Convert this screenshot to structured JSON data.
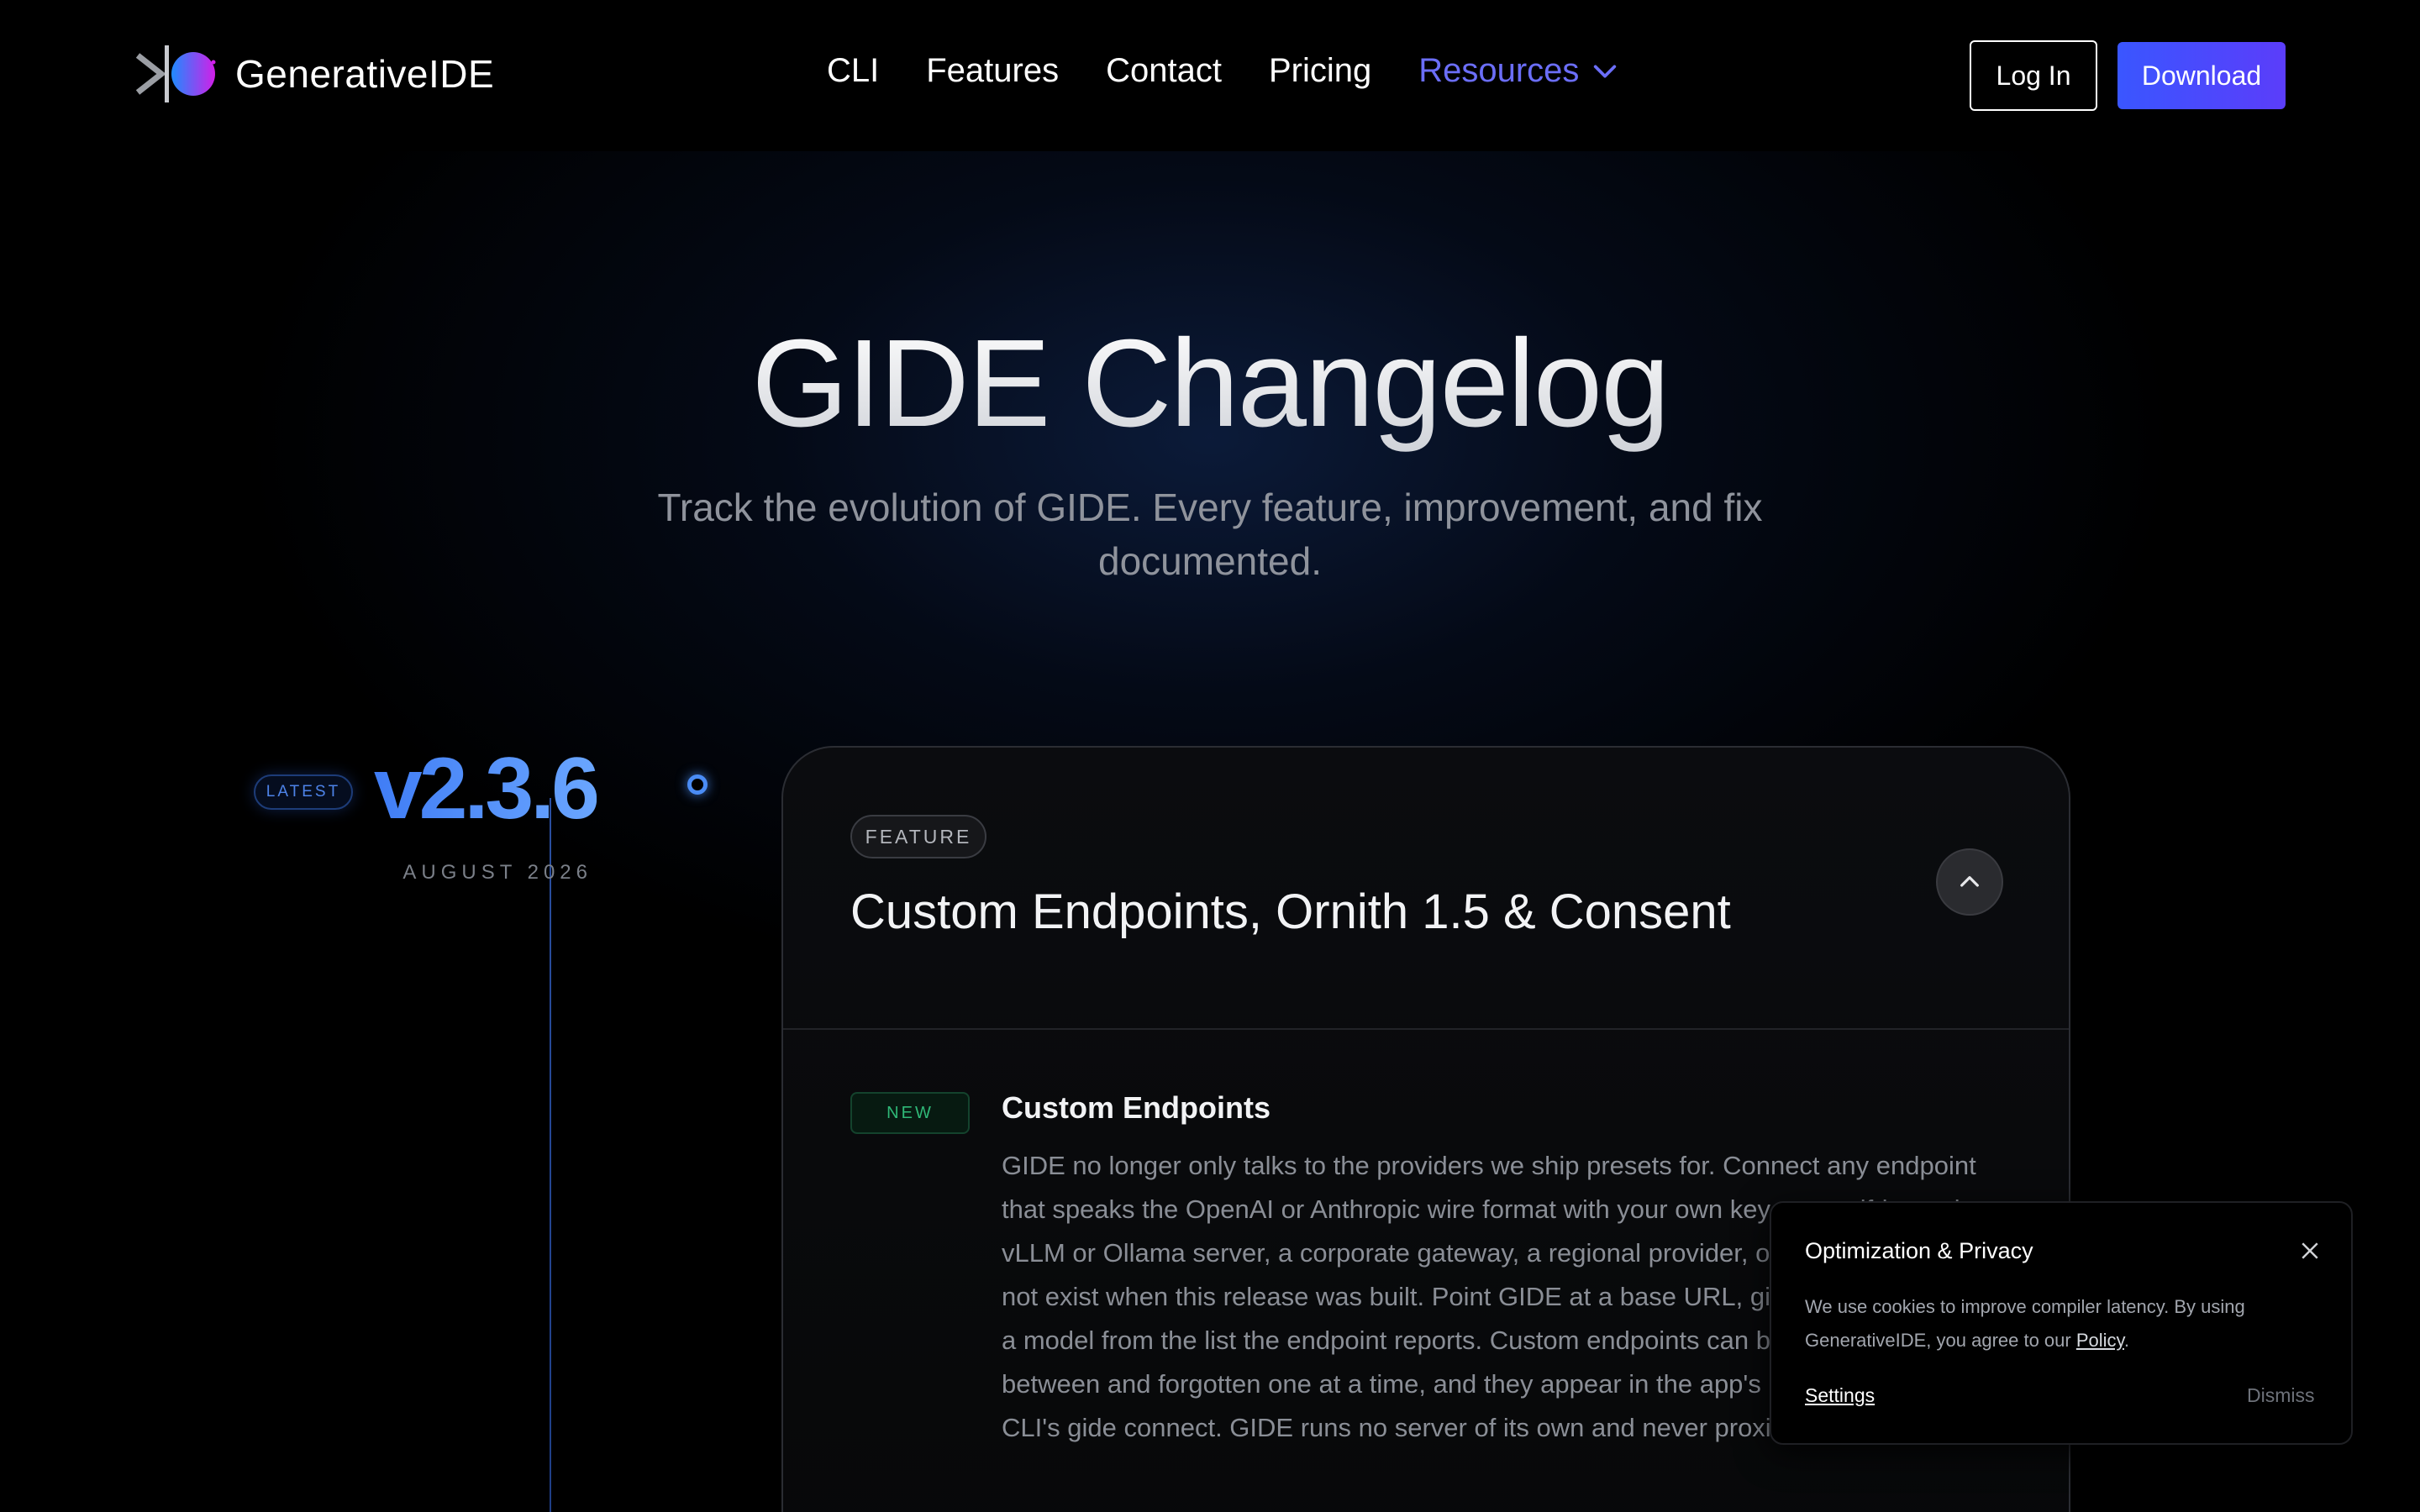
{
  "nav": {
    "brand": "GenerativeIDE",
    "links": [
      {
        "label": "CLI"
      },
      {
        "label": "Features"
      },
      {
        "label": "Contact"
      },
      {
        "label": "Pricing"
      }
    ],
    "resources_label": "Resources",
    "login_label": "Log In",
    "download_label": "Download"
  },
  "hero": {
    "title": "GIDE Changelog",
    "subtitle": "Track the evolution of GIDE. Every feature, improvement, and fix documented."
  },
  "release": {
    "badge": "LATEST",
    "version": "v2.3.6",
    "date": "AUGUST 2026",
    "type_badge": "FEATURE",
    "title": "Custom Endpoints, Ornith 1.5 & Consent",
    "entries": [
      {
        "tag": "NEW",
        "title": "Custom Endpoints",
        "body": "GIDE no longer only talks to the providers we ship presets for. Connect any endpoint that speaks the OpenAI or Anthropic wire format with your own key — a self-hosted vLLM or Ollama server, a corporate gateway, a regional provider, or a provider that did not exist when this release was built. Point GIDE at a base URL, give it a key, and pick a model from the list the endpoint reports. Custom endpoints can be added, switched between and forgotten one at a time, and they appear in the app's model picker and the CLI's gide connect. GIDE runs no server of its own and never proxies your prompts."
      }
    ]
  },
  "cookie": {
    "title": "Optimization & Privacy",
    "text_before": "We use cookies to improve compiler latency. By using GenerativeIDE, you agree to our ",
    "policy_label": "Policy",
    "text_after": ".",
    "settings_label": "Settings",
    "dismiss_label": "Dismiss"
  },
  "colors": {
    "accent": "#6b6ef8",
    "download_start": "#3a56ff",
    "download_end": "#5b3dfa",
    "version_blue": "#4a8cf5",
    "new_green": "#2fb877"
  },
  "icons": {
    "logo": "gt-bar-orb-logo",
    "resources": "chevron-down-icon",
    "collapse": "chevron-up-icon",
    "cookie_close": "close-icon"
  }
}
